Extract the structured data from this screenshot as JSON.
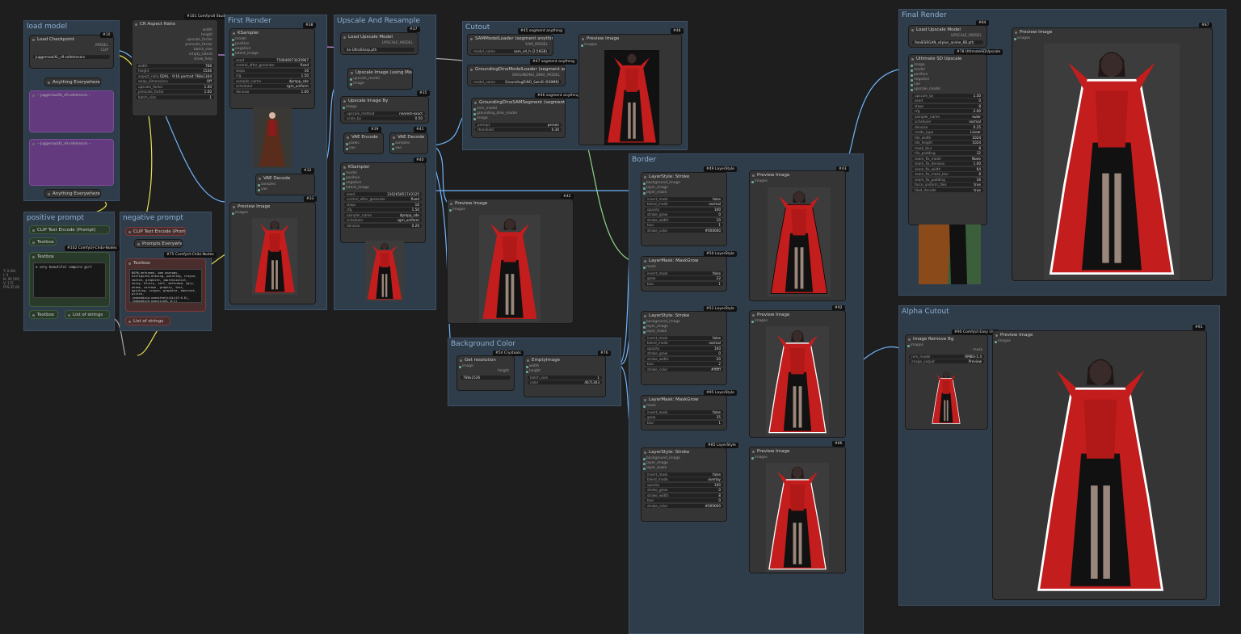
{
  "groups": {
    "load_model": "load model",
    "positive_prompt": "positive prompt",
    "negative_prompt": "negative prompt",
    "first_render": "First Render",
    "upscale": "Upscale And Resample",
    "cutout": "Cutout",
    "background_color": "Background Color",
    "border": "Border",
    "final_render": "Final Render",
    "alpha_cutout": "Alpha Cutout"
  },
  "badges": {
    "b101": "#101 Comfyroll Studio",
    "b10": "#10",
    "b38": "#38",
    "b37": "#37",
    "b35": "#35",
    "b45": "#45 segment anything",
    "b47": "#47 segment anything",
    "b46": "#46 segment anything",
    "b48": "#48",
    "b32": "#32",
    "b33": "#33",
    "b39": "#39",
    "b41": "#41",
    "b40": "#40",
    "b34": "#34",
    "b42": "#42",
    "b102": "#102 ComfyUI-Chibi-Nodes",
    "b75": "#75 ComfyUI-Chibi-Nodes",
    "b54": "#54 Crystools",
    "b76": "#76",
    "b49": "#49 LayerStyle",
    "b43": "#43",
    "b50": "#50 LayerStyle",
    "b51": "#51 LayerStyle",
    "b92": "#92",
    "b95": "#95 LayerStyle",
    "b85": "#85 LayerStyle",
    "b86": "#86",
    "b84": "#84",
    "b87": "#87",
    "b78": "#78 UltimateSDUpscale",
    "b90": "#90 ComfyUI Easy Use",
    "b91": "#91"
  },
  "nodes": {
    "load_checkpoint": {
      "title": "Load Checkpoint",
      "ckpt": "JuggernautXL_v9.safetensors",
      "out_model": "MODEL",
      "out_clip": "CLIP",
      "out_vae": "VAE"
    },
    "anything_everywhere_1": "Anything Everywhere",
    "anything_everywhere_2": "Anything Everywhere",
    "muted_1": "-- JuggernautXL_v9.safetensors --",
    "muted_2": "-- JuggernautXL_v9.safetensors --",
    "aspect": {
      "title": "CR Aspect Ratio",
      "outs": [
        "width",
        "height",
        "upscale_factor",
        "prescale_factor",
        "batch_size",
        "empty_latent",
        "show_help"
      ],
      "widgets": [
        [
          "width",
          "768"
        ],
        [
          "height",
          "1536"
        ],
        [
          "aspect_ratio",
          "SDXL - 9:16 portrait 768x1344"
        ],
        [
          "swap_dimensions",
          "Off"
        ],
        [
          "upscale_factor",
          "1.00"
        ],
        [
          "prescale_factor",
          "1.00"
        ],
        [
          "batch_size",
          "1"
        ]
      ]
    },
    "ksampler1": {
      "title": "KSampler",
      "ins": [
        "model",
        "positive",
        "negative",
        "latent_image"
      ],
      "out": "LATENT",
      "widgets": [
        [
          "seed",
          "750846973035967"
        ],
        [
          "control_after_generate",
          "fixed"
        ],
        [
          "steps",
          "16"
        ],
        [
          "cfg",
          "1.50"
        ],
        [
          "sampler_name",
          "dpmpp_sde"
        ],
        [
          "scheduler",
          "sgm_uniform"
        ],
        [
          "denoise",
          "1.00"
        ]
      ]
    },
    "vae_decode1": {
      "title": "VAE Decode",
      "ins": [
        "samples",
        "vae"
      ],
      "out": "IMAGE"
    },
    "preview1": {
      "title": "Preview Image",
      "in": "images"
    },
    "load_upscale": {
      "title": "Load Upscale Model",
      "out": "UPSCALE_MODEL",
      "model": "4x-UltraSharp.pth"
    },
    "upscale_using": {
      "title": "Upscale Image (using Model)",
      "ins": [
        "upscale_model",
        "image"
      ],
      "out": "IMAGE"
    },
    "upscale_by": {
      "title": "Upscale Image By",
      "in": "image",
      "out": "IMAGE",
      "widgets": [
        [
          "upscale_method",
          "nearest-exact"
        ],
        [
          "scale_by",
          "0.50"
        ]
      ]
    },
    "vae_encode": {
      "title": "VAE Encode",
      "ins": [
        "pixels",
        "vae"
      ],
      "out": "LATENT"
    },
    "vae_decode2": {
      "title": "VAE Decode",
      "ins": [
        "samples",
        "vae"
      ],
      "out": "IMAGE"
    },
    "ksampler2": {
      "title": "KSampler",
      "ins": [
        "model",
        "positive",
        "negative",
        "latent_image"
      ],
      "out": "LATENT",
      "widgets": [
        [
          "seed",
          "316265851743125"
        ],
        [
          "control_after_generate",
          "fixed"
        ],
        [
          "steps",
          "16"
        ],
        [
          "cfg",
          "1.50"
        ],
        [
          "sampler_name",
          "dpmpp_sde"
        ],
        [
          "scheduler",
          "sgm_uniform"
        ],
        [
          "denoise",
          "0.20"
        ]
      ]
    },
    "sam_loader": {
      "title": "SAMModelLoader (segment anything)",
      "out": "SAM_MODEL",
      "widgets": [
        [
          "model_name",
          "sam_vit_h (2.56GB)"
        ]
      ]
    },
    "dino_loader": {
      "title": "GroundingDinoModelLoader (segment anything)",
      "out": "GROUNDING_DINO_MODEL",
      "widgets": [
        [
          "model_name",
          "GroundingDINO_SwinB (938MB)"
        ]
      ]
    },
    "dino_sam": {
      "title": "GroundingDinoSAMSegment (segment anything)",
      "ins": [
        "sam_model",
        "grounding_dino_model",
        "image"
      ],
      "outs": [
        "IMAGE",
        "MASK"
      ],
      "widgets": [
        [
          "prompt",
          "person"
        ],
        [
          "threshold",
          "0.30"
        ]
      ]
    },
    "preview_cut": {
      "title": "Preview Image",
      "in": "images"
    },
    "preview2": {
      "title": "Preview Image",
      "in": "images"
    },
    "preview3": {
      "title": "Preview Image",
      "in": "images"
    },
    "textbox_pos": {
      "title": "Textbox",
      "label": "Textbox",
      "text": "a very beautiful vampire girl"
    },
    "clip_pos": {
      "title": "CLIP Text Encode (Prompt)"
    },
    "textbox_neg": {
      "title": "Textbox",
      "label": "Textbox",
      "text": "NSFW,deformed, bad anatomy, disfigured,drawing, painting, crayon, sketch, graphite, impressionist, noisy, blurry, soft, deformed, ugly, anime, cartoon, graphic, text, painting, crayon, graphite, abstract, glitch,(embedding:unaestheticXLv13:0.8),(embedding:negativeXL_D:1)"
    },
    "clip_neg": {
      "title": "CLIP Text Encode (Prompt)"
    },
    "prompts_everywhere": "Prompts Everywhere",
    "list_strings_1": "List of strings",
    "list_strings_2": "List of strings",
    "get_res": {
      "title": "Get resolution",
      "in": "image",
      "outs": [
        "width",
        "height"
      ],
      "value": "768x1536"
    },
    "empty_image": {
      "title": "EmptyImage",
      "ins": [
        "width",
        "height"
      ],
      "out": "IMAGE",
      "widgets": [
        [
          "batch_size",
          "1"
        ],
        [
          "color",
          "4671303"
        ]
      ]
    },
    "stroke1": {
      "title": "LayerStyle: Stroke",
      "ins": [
        "background_image",
        "layer_image",
        "layer_mask"
      ],
      "out": "image",
      "widgets": [
        [
          "invert_mask",
          "false"
        ],
        [
          "blend_mode",
          "normal"
        ],
        [
          "opacity",
          "100"
        ],
        [
          "stroke_grow",
          "0"
        ],
        [
          "stroke_width",
          "10"
        ],
        [
          "blur",
          "1"
        ],
        [
          "stroke_color",
          "#000000"
        ]
      ]
    },
    "maskgrow1": {
      "title": "LayerMask: MaskGrow",
      "in": "mask",
      "out": "mask",
      "widgets": [
        [
          "invert_mask",
          "false"
        ],
        [
          "grow",
          "22"
        ],
        [
          "blur",
          "1"
        ]
      ]
    },
    "stroke2": {
      "title": "LayerStyle: Stroke",
      "ins": [
        "background_image",
        "layer_image",
        "layer_mask"
      ],
      "out": "image",
      "widgets": [
        [
          "invert_mask",
          "false"
        ],
        [
          "blend_mode",
          "normal"
        ],
        [
          "opacity",
          "100"
        ],
        [
          "stroke_grow",
          "0"
        ],
        [
          "stroke_width",
          "20"
        ],
        [
          "blur",
          "2"
        ],
        [
          "stroke_color",
          "#ffffff"
        ]
      ]
    },
    "maskgrow2": {
      "title": "LayerMask: MaskGrow",
      "in": "mask",
      "out": "mask",
      "widgets": [
        [
          "invert_mask",
          "false"
        ],
        [
          "grow",
          "35"
        ],
        [
          "blur",
          "1"
        ]
      ]
    },
    "stroke3": {
      "title": "LayerStyle: Stroke",
      "ins": [
        "background_image",
        "layer_image",
        "layer_mask"
      ],
      "out": "image",
      "widgets": [
        [
          "invert_mask",
          "false"
        ],
        [
          "blend_mode",
          "overlay"
        ],
        [
          "opacity",
          "100"
        ],
        [
          "stroke_grow",
          "0"
        ],
        [
          "stroke_width",
          "8"
        ],
        [
          "blur",
          "0"
        ],
        [
          "stroke_color",
          "#000000"
        ]
      ]
    },
    "pv_border1": {
      "title": "Preview Image",
      "in": "images"
    },
    "pv_border2": {
      "title": "Preview Image",
      "in": "images"
    },
    "pv_border3": {
      "title": "Preview Image",
      "in": "images"
    },
    "load_upscale2": {
      "title": "Load Upscale Model",
      "out": "UPSCALE_MODEL",
      "model": "RealESRGAN_x4plus_anime_6B.pth"
    },
    "ultimate": {
      "title": "Ultimate SD Upscale",
      "ins": [
        "image",
        "model",
        "positive",
        "negative",
        "vae",
        "upscale_model"
      ],
      "out": "IMAGE",
      "widgets": [
        [
          "upscale_by",
          "1.50"
        ],
        [
          "seed",
          "0"
        ],
        [
          "steps",
          "8"
        ],
        [
          "cfg",
          "2.00"
        ],
        [
          "sampler_name",
          "euler"
        ],
        [
          "scheduler",
          "normal"
        ],
        [
          "denoise",
          "0.25"
        ],
        [
          "mode_type",
          "Linear"
        ],
        [
          "tile_width",
          "1024"
        ],
        [
          "tile_height",
          "1024"
        ],
        [
          "mask_blur",
          "8"
        ],
        [
          "tile_padding",
          "32"
        ],
        [
          "seam_fix_mode",
          "None"
        ],
        [
          "seam_fix_denoise",
          "1.00"
        ],
        [
          "seam_fix_width",
          "64"
        ],
        [
          "seam_fix_mask_blur",
          "8"
        ],
        [
          "seam_fix_padding",
          "16"
        ],
        [
          "force_uniform_tiles",
          "true"
        ],
        [
          "tiled_decode",
          "true"
        ]
      ]
    },
    "preview_final": {
      "title": "Preview Image",
      "in": "images"
    },
    "remove_bg": {
      "title": "Image Remove Bg",
      "in": "images",
      "outs": [
        "image",
        "mask"
      ],
      "widgets": [
        [
          "rem_model",
          "RMBG-1.4"
        ],
        [
          "image_output",
          "Preview"
        ]
      ]
    },
    "preview_alpha": {
      "title": "Preview Image",
      "in": "images"
    }
  },
  "sidebar_info": [
    "T: 0.00s",
    "I: 0",
    "N: 99 [99]",
    "V: 172",
    "FPS:35.00"
  ],
  "colors": {
    "group_bg": "#2f3d4b",
    "link_blue": "#6fb6ff",
    "link_yellow": "#e6e053",
    "link_green": "#8ed889",
    "link_purple": "#c58fe6",
    "dress_red": "#c31d1d"
  }
}
